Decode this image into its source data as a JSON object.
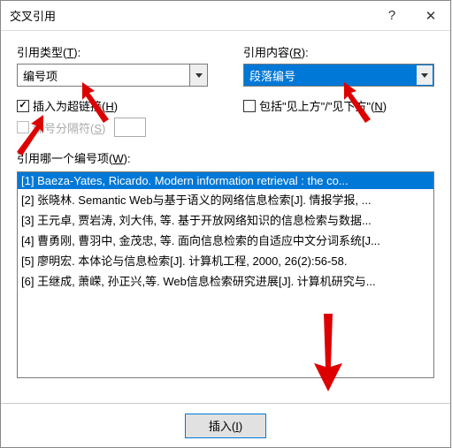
{
  "titlebar": {
    "title": "交叉引用",
    "help": "?",
    "close": "✕"
  },
  "left": {
    "type_label": "引用类型(",
    "type_key": "T",
    "type_label_end": "):",
    "type_value": "编号项",
    "hyperlink_label": "插入为超链接(",
    "hyperlink_key": "H",
    "hyperlink_label_end": ")",
    "sep_label": "编号分隔符(",
    "sep_key": "S",
    "sep_label_end": ")"
  },
  "right": {
    "content_label": "引用内容(",
    "content_key": "R",
    "content_label_end": "):",
    "content_value": "段落编号",
    "include_label": "包括\"见上方\"/\"见下方\"(",
    "include_key": "N",
    "include_label_end": ")"
  },
  "list": {
    "label": "引用哪一个编号项(",
    "key": "W",
    "label_end": "):",
    "items": [
      "[1] Baeza-Yates, Ricardo. Modern information retrieval : the co...",
      "[2] 张晓林. Semantic Web与基于语义的网络信息检索[J]. 情报学报, ...",
      "[3] 王元卓, 贾岩涛, 刘大伟, 等. 基于开放网络知识的信息检索与数据...",
      "[4] 曹勇刚, 曹羽中, 金茂忠, 等. 面向信息检索的自适应中文分词系统[J...",
      "[5] 廖明宏. 本体论与信息检索[J]. 计算机工程, 2000, 26(2):56-58.",
      "[6] 王继成, 萧嵘, 孙正兴,等. Web信息检索研究进展[J]. 计算机研究与..."
    ]
  },
  "footer": {
    "insert": "插入(",
    "insert_key": "I",
    "insert_end": ")"
  }
}
